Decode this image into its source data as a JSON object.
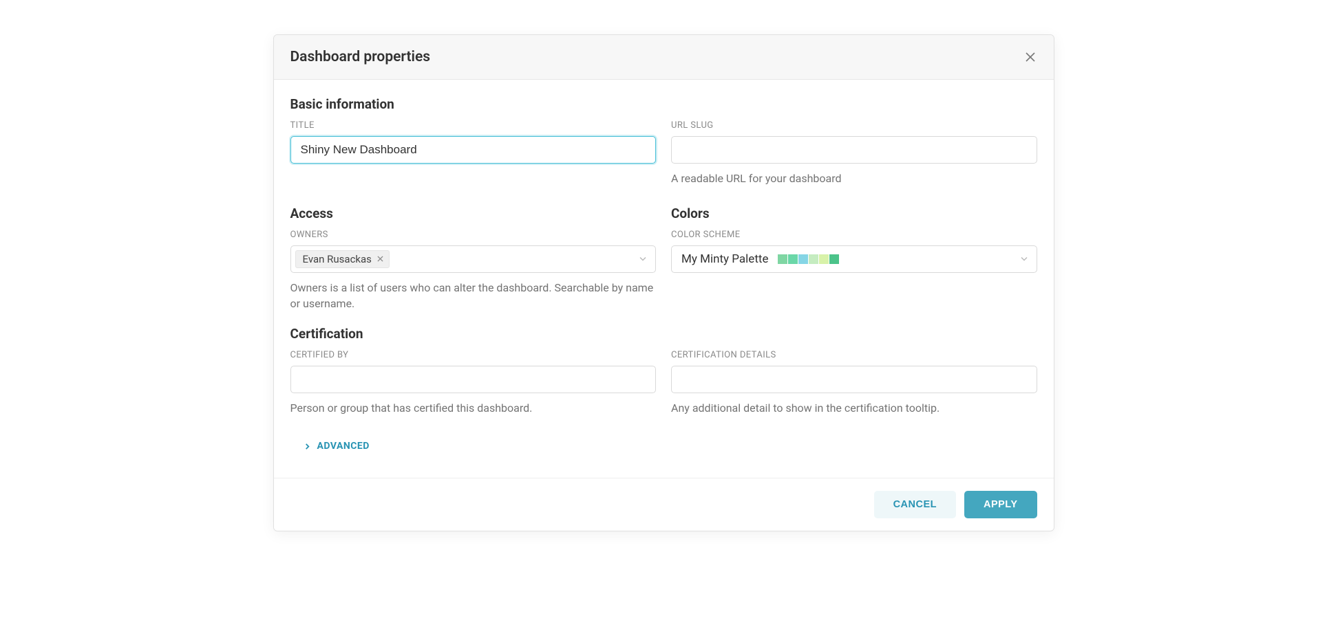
{
  "modal": {
    "title": "Dashboard properties"
  },
  "sections": {
    "basic": {
      "title": "Basic information"
    },
    "access": {
      "title": "Access"
    },
    "colors": {
      "title": "Colors"
    },
    "certification": {
      "title": "Certification"
    }
  },
  "fields": {
    "title": {
      "label": "TITLE",
      "value": "Shiny New Dashboard"
    },
    "url_slug": {
      "label": "URL SLUG",
      "value": "",
      "help": "A readable URL for your dashboard"
    },
    "owners": {
      "label": "OWNERS",
      "tags": [
        "Evan Rusackas"
      ],
      "help": "Owners is a list of users who can alter the dashboard. Searchable by name or username."
    },
    "color_scheme": {
      "label": "COLOR SCHEME",
      "selected_name": "My Minty Palette",
      "swatches": [
        "#7fd6a3",
        "#6ad7a8",
        "#85d5e5",
        "#c5ecc0",
        "#d8f2a9",
        "#4cc38a"
      ]
    },
    "certified_by": {
      "label": "CERTIFIED BY",
      "value": "",
      "help": "Person or group that has certified this dashboard."
    },
    "certification_details": {
      "label": "CERTIFICATION DETAILS",
      "value": "",
      "help": "Any additional detail to show in the certification tooltip."
    }
  },
  "advanced": {
    "label": "ADVANCED"
  },
  "buttons": {
    "cancel": "CANCEL",
    "apply": "APPLY"
  }
}
